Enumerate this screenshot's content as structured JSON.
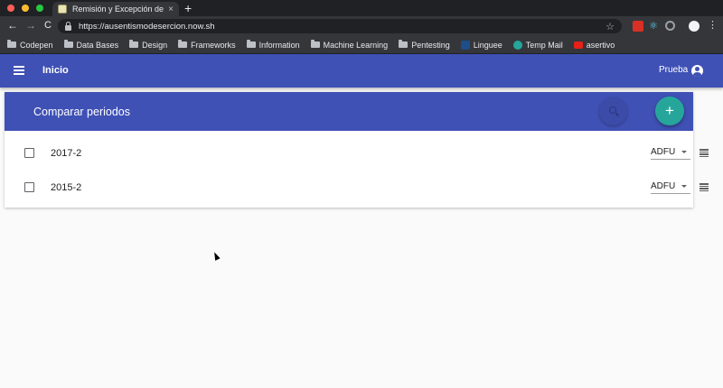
{
  "browser": {
    "tab_title": "Remisión y Excepción de ausen",
    "tab_close": "×",
    "new_tab": "+",
    "url": "https://ausentismodesercion.now.sh",
    "back": "←",
    "forward": "→",
    "reload": "C",
    "star": "☆",
    "menu": "⋮",
    "react_ext": "⚛"
  },
  "bookmarks": [
    {
      "label": "Codepen",
      "icon": "folder-icon"
    },
    {
      "label": "Data Bases",
      "icon": "folder-icon"
    },
    {
      "label": "Design",
      "icon": "folder-icon"
    },
    {
      "label": "Frameworks",
      "icon": "folder-icon"
    },
    {
      "label": "Information",
      "icon": "folder-icon"
    },
    {
      "label": "Machine Learning",
      "icon": "folder-icon"
    },
    {
      "label": "Pentesting",
      "icon": "folder-icon"
    },
    {
      "label": "Linguee",
      "icon": "linguee-icon"
    },
    {
      "label": "Temp Mail",
      "icon": "temp-mail-icon"
    },
    {
      "label": "asertivo",
      "icon": "youtube-icon"
    }
  ],
  "appbar": {
    "title": "Inicio",
    "user": "Prueba"
  },
  "card": {
    "title": "Comparar periodos",
    "add_label": "+",
    "rows": [
      {
        "period": "2017-2",
        "program": "ADFU"
      },
      {
        "period": "2015-2",
        "program": "ADFU"
      }
    ]
  },
  "colors": {
    "primary": "#3f51b5",
    "accent": "#26a69a",
    "chrome": "#35363a"
  }
}
